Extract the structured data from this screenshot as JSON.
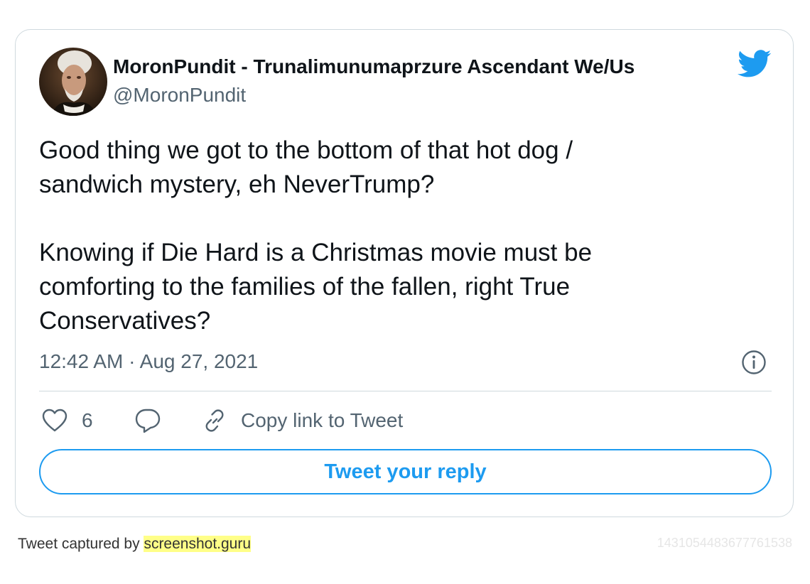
{
  "author": {
    "display_name": "MoronPundit - Trunalimunumaprzure Ascendant We/Us",
    "handle": "@MoronPundit",
    "avatar_icon": "portrait-avatar"
  },
  "tweet": {
    "text": "Good thing we got to the bottom of that hot dog /\nsandwich mystery, eh NeverTrump?\n\nKnowing if Die Hard is a Christmas movie must be\ncomforting to the families of the fallen, right True\nConservatives?",
    "timestamp": "12:42 AM · Aug 27, 2021"
  },
  "actions": {
    "like_count": "6",
    "copy_link_label": "Copy link to Tweet",
    "reply_button_label": "Tweet your reply"
  },
  "footer": {
    "caption_prefix": "Tweet captured by ",
    "link_text": "screenshot.guru",
    "tweet_id": "1431054483677761538"
  },
  "colors": {
    "brand_blue": "#1d9bf0",
    "secondary_text": "#536471",
    "border": "#cfd9de",
    "highlight": "#ffff88"
  },
  "icons": [
    "twitter-bird-icon",
    "info-icon",
    "heart-icon",
    "reply-bubble-icon",
    "link-icon"
  ]
}
